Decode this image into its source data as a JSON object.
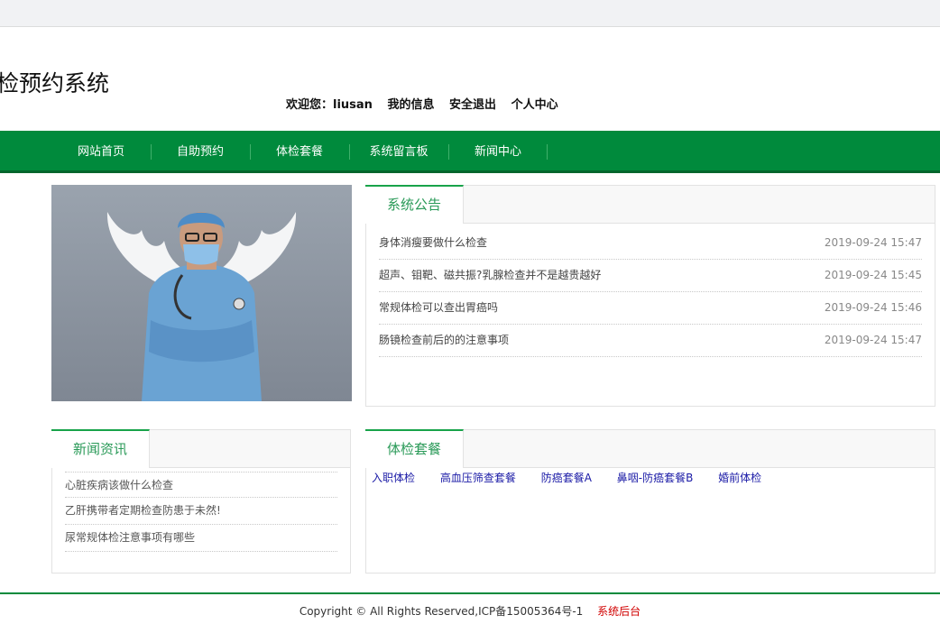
{
  "header": {
    "site_title": "检预约系统",
    "welcome": "欢迎您：liusan",
    "my_info": "我的信息",
    "logout": "安全退出",
    "personal_center": "个人中心"
  },
  "nav": {
    "items": [
      "网站首页",
      "自助预约",
      "体检套餐",
      "系统留言板",
      "新闻中心"
    ]
  },
  "notice": {
    "title": "系统公告",
    "items": [
      {
        "title": "身体消瘦要做什么检查",
        "date": "2019-09-24 15:47"
      },
      {
        "title": "超声、钼靶、磁共振?乳腺检查并不是越贵越好",
        "date": "2019-09-24 15:45"
      },
      {
        "title": "常规体检可以查出胃癌吗",
        "date": "2019-09-24 15:46"
      },
      {
        "title": "肠镜检查前后的的注意事项",
        "date": "2019-09-24 15:47"
      }
    ]
  },
  "news": {
    "title": "新闻资讯",
    "items": [
      "心脏疾病该做什么检查",
      "乙肝携带者定期检查防患于未然!",
      "尿常规体检注意事项有哪些"
    ]
  },
  "packages": {
    "title": "体检套餐",
    "items": [
      "入职体检",
      "高血压筛查套餐",
      "防癌套餐A",
      "鼻咽-防癌套餐B",
      "婚前体检"
    ]
  },
  "footer": {
    "copyright": "Copyright © All Rights Reserved,ICP备15005364号-1",
    "admin_link": "系统后台"
  },
  "colors": {
    "nav_green": "#008a3c",
    "tab_accent": "#18a34a",
    "link_blue": "#1a1aa6",
    "admin_red": "#d10000"
  }
}
